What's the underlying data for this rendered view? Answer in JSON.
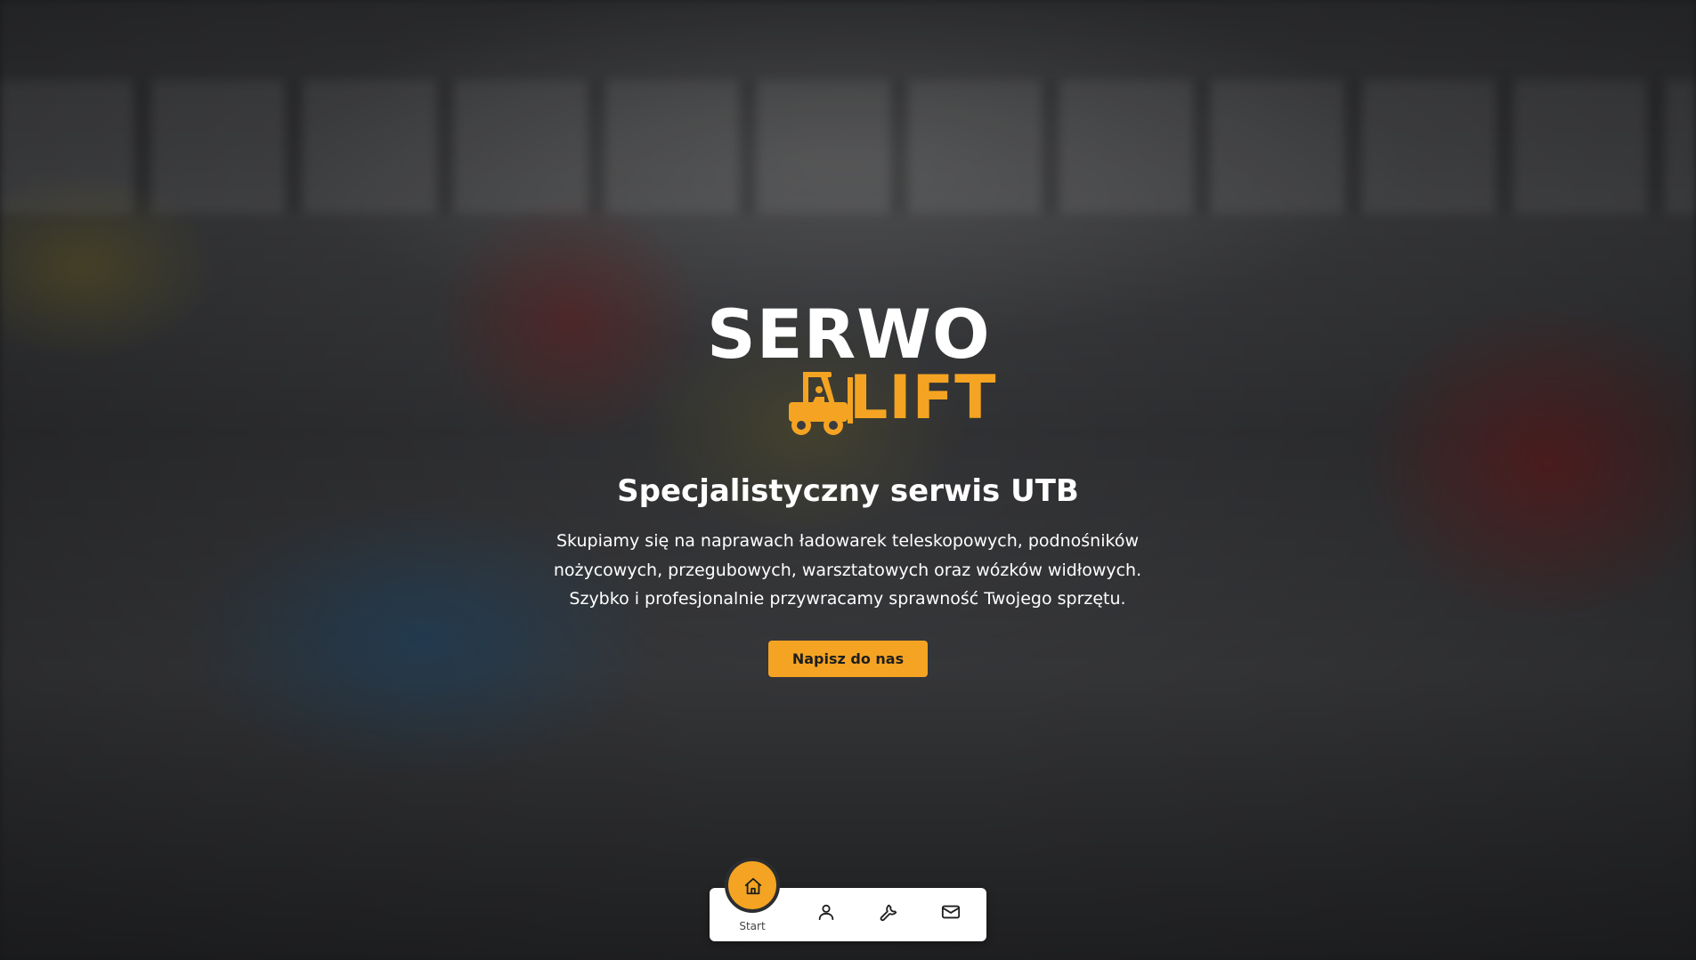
{
  "logo": {
    "line1": "SERWO",
    "line2": "LIFT",
    "icon": "forklift-icon",
    "colors": {
      "white": "#ffffff",
      "orange": "#f4a422"
    }
  },
  "hero": {
    "title": "Specjalistyczny serwis UTB",
    "description_lines": [
      "Skupiamy się na naprawach ładowarek teleskopowych, podnośników",
      "nożycowych, przegubowych, warsztatowych oraz wózków widłowych.",
      "Szybko i profesjonalnie przywracamy sprawność Twojego sprzętu."
    ],
    "cta_label": "Napisz do nas",
    "cta_color": "#f4a422"
  },
  "bottom_nav": {
    "items": [
      {
        "label": "Start",
        "icon": "home-icon",
        "active": true
      },
      {
        "label": "",
        "icon": "user-icon",
        "active": false
      },
      {
        "label": "",
        "icon": "wrench-icon",
        "active": false
      },
      {
        "label": "",
        "icon": "mail-icon",
        "active": false
      }
    ],
    "active_color": "#f4a422"
  }
}
